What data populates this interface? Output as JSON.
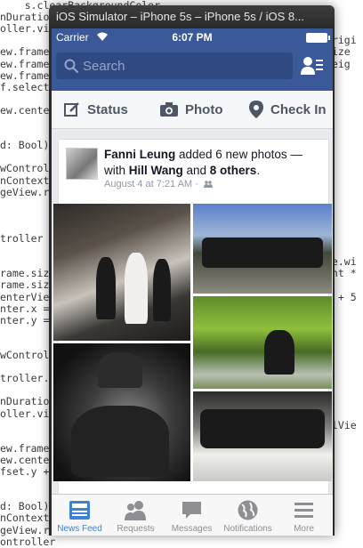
{
  "background_code": {
    "left": [
      "    s.clearBackgroundColor",
      "nDuration",
      "oller.view",
      "",
      "ew.frame",
      "ew.frame",
      "ew.frame",
      "f.selecte",
      "",
      "ew.center",
      "",
      "",
      "d: Bool)",
      "",
      "wControll",
      "nContext.",
      "geView.re",
      "",
      "",
      "",
      "troller =",
      "",
      "",
      "rame.size",
      "rame.size",
      "enterView",
      "nter.x =",
      "nter.y =",
      "",
      "",
      "wControll",
      "",
      "troller.image",
      "",
      "nDuration",
      "oller.view",
      "",
      "",
      "ew.frame",
      "ew.cente",
      "fset.y +",
      "",
      "",
      "d: Bool)",
      "nContext.",
      "geView.re",
      "ontroller"
    ],
    "right": [
      "",
      "",
      "",
      "origi",
      "size",
      "heig",
      "",
      "",
      "",
      "",
      "",
      "",
      "",
      "",
      "",
      "",
      "",
      "",
      "",
      "",
      "",
      "",
      "ze.wi",
      "ght *",
      "",
      "y + 5",
      "",
      "",
      "",
      "",
      "",
      "",
      "",
      "",
      "",
      "",
      "llVie",
      "",
      "",
      "",
      "",
      "",
      "",
      ""
    ]
  },
  "window": {
    "title": "iOS Simulator – iPhone 5s – iPhone 5s / iOS 8..."
  },
  "status_bar": {
    "carrier": "Carrier",
    "time": "6:07 PM"
  },
  "search": {
    "placeholder": "Search"
  },
  "actions": {
    "status": "Status",
    "photo": "Photo",
    "checkin": "Check In"
  },
  "post": {
    "author": "Fanni Leung",
    "text_mid": " added 6 new photos — with ",
    "tagged": "Hill Wang",
    "and": " and ",
    "others": "8 others",
    "end": ".",
    "timestamp": "August 4 at 7:21 AM",
    "separator": "·"
  },
  "tabbar": {
    "items": [
      "News Feed",
      "Requests",
      "Messages",
      "Notifications",
      "More"
    ]
  },
  "colors": {
    "facebook_blue": "#3b5998",
    "tab_active": "#3b82d6"
  }
}
